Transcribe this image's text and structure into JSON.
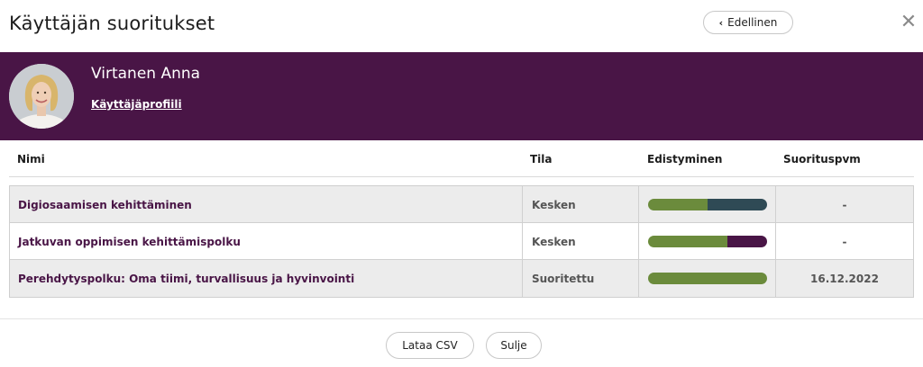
{
  "modal": {
    "title": "Käyttäjän suoritukset",
    "prev_label": "Edellinen",
    "prev_icon": "chevron-left-icon",
    "close_icon": "close-icon"
  },
  "user": {
    "name": "Virtanen Anna",
    "profile_link": "Käyttäjäprofiili"
  },
  "colors": {
    "header_band": "#491546",
    "progress_green": "#6b8b3c",
    "progress_slate": "#2f4a55",
    "progress_purple": "#491546"
  },
  "table": {
    "headers": [
      "Nimi",
      "Tila",
      "Edistyminen",
      "Suorituspvm"
    ],
    "rows": [
      {
        "name": "Digiosaamisen kehittäminen",
        "status": "Kesken",
        "progress": 0.5,
        "rest_color": "#2f4a55",
        "date": "-"
      },
      {
        "name": "Jatkuvan oppimisen kehittämispolku",
        "status": "Kesken",
        "progress": 0.67,
        "rest_color": "#491546",
        "date": "-"
      },
      {
        "name": "Perehdytyspolku: Oma tiimi, turvallisuus ja hyvinvointi",
        "status": "Suoritettu",
        "progress": 1.0,
        "rest_color": "#6b8b3c",
        "date": "16.12.2022"
      }
    ]
  },
  "footer": {
    "csv_label": "Lataa CSV",
    "close_label": "Sulje"
  }
}
